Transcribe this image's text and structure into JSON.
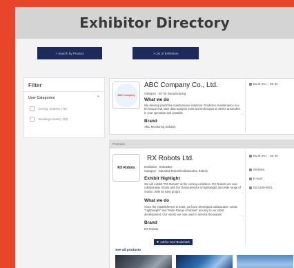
{
  "header": {
    "title": "Exhibitor Directory"
  },
  "search": {
    "by_product_label": "> Search by Product",
    "list_label": "> List of Exhibitors"
  },
  "filter": {
    "title": "Filter",
    "category_label": "User Categories",
    "options": [
      "Energy Industry (75)",
      "Building Industry (93)"
    ]
  },
  "card1": {
    "logo_text": "ABC Company",
    "name": "ABC Company Co., Ltd.",
    "category": "Category : IoT for manufacturing",
    "whatwedo_heading": "What we do",
    "whatwedo_text": "We develop predictive maintenance solutions. Predictive maintenance is a technique that uses data analysis tools and techniques to detect anomalies in your operation and possible",
    "more": "...",
    "brand_heading": "Brand",
    "brand_text": "ABC Monitoring Solution",
    "booth": "Booth No. : S6-25"
  },
  "card2": {
    "premium_label": "Premium",
    "logo_text": "RX Robots",
    "name": "RX Robots Ltd.",
    "exhibition": "Exhibition : RoboDEX",
    "category": "Category : Industrial Robots/Collaborative Robots",
    "highlight_heading": "Exhibit Highlight",
    "highlight_text": "We will exhibit \"RX Robots\" at the coming exhibition. RX Robots are new collaborative robots with the characteristics of lightweight and wide range of motion. With its easy progra",
    "highlight_more": "...",
    "whatwedo_heading": "What we do",
    "whatwedo_text": "Since the establishment in 2020, we have developed collaborative robots \"Lightweight\" and \"Wide Range of Motion\" are key to our robot development. Our robots are now used in several thousands",
    "whatwedo_more": "...",
    "brand_heading": "Brand",
    "brand_text": "RX Robots",
    "bookmark_label": "Add to Your Bookmark",
    "see_all": "See all products",
    "booth": "Booth No. : S2-46",
    "website": "Website",
    "email": "E-mail",
    "phone": "03-3349-8501"
  }
}
